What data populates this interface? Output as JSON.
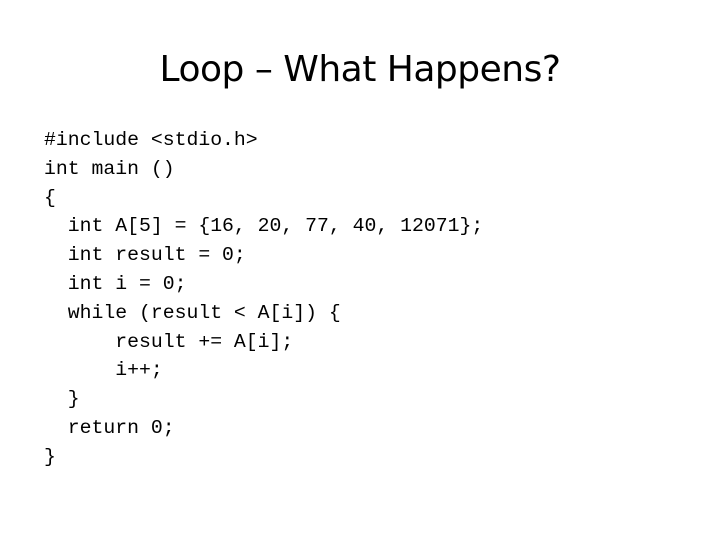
{
  "slide": {
    "title": "Loop – What Happens?",
    "code_lines": [
      "#include <stdio.h>",
      "int main ()",
      "{",
      "  int A[5] = {16, 20, 77, 40, 12071};",
      "  int result = 0;",
      "  int i = 0;",
      "  while (result < A[i]) {",
      "      result += A[i];",
      "      i++;",
      "  }",
      "  return 0;",
      "}"
    ]
  }
}
